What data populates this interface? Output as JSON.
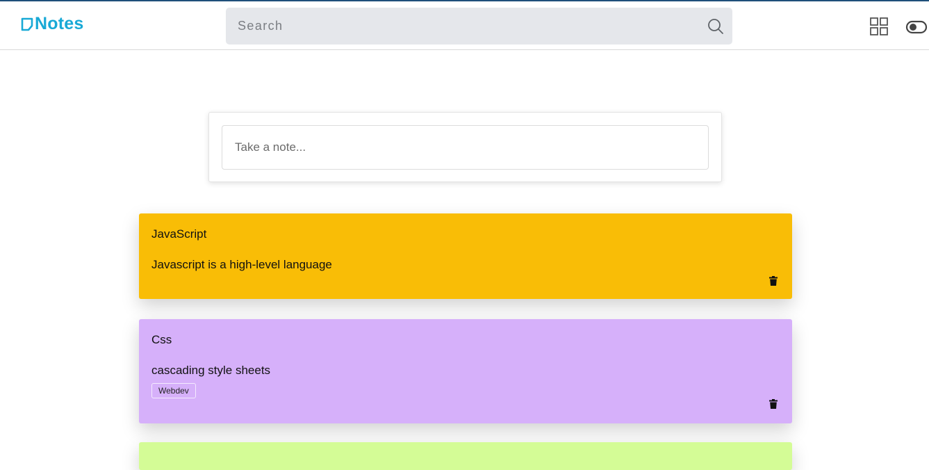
{
  "app": {
    "logo_text": "Notes",
    "accent_color": "#18a9d6"
  },
  "search": {
    "placeholder": "Search",
    "value": ""
  },
  "toolbar": {
    "grid_icon": "grid-view-icon",
    "theme_icon": "toggle-icon"
  },
  "composer": {
    "placeholder": "Take a note...",
    "value": ""
  },
  "notes": [
    {
      "title": "JavaScript",
      "body": "Javascript is a high-level language",
      "tags": [],
      "color": "#f9bd06"
    },
    {
      "title": "Css",
      "body": "cascading style sheets",
      "tags": [
        "Webdev"
      ],
      "color": "#d6b0fa"
    },
    {
      "color": "#d4fc96"
    }
  ]
}
